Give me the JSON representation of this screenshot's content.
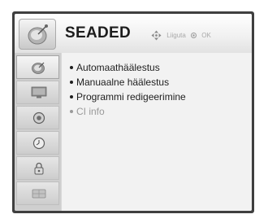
{
  "header": {
    "title": "SEADED",
    "icon": "satellite-dish-icon",
    "hints": [
      {
        "icon": "navigation-arrows-icon",
        "label": "Liiguta"
      },
      {
        "icon": "ok-button-icon",
        "label": "OK"
      }
    ]
  },
  "sidebar": {
    "items": [
      {
        "icon": "satellite-dish-icon",
        "active": true
      },
      {
        "icon": "monitor-icon",
        "active": false
      },
      {
        "icon": "speaker-icon",
        "active": false
      },
      {
        "icon": "clock-icon",
        "active": false
      },
      {
        "icon": "lock-icon",
        "active": false
      },
      {
        "icon": "globe-icon",
        "active": false
      }
    ]
  },
  "menu": {
    "items": [
      {
        "label": "Automaathäälestus",
        "enabled": true
      },
      {
        "label": "Manuaalne häälestus",
        "enabled": true
      },
      {
        "label": "Programmi redigeerimine",
        "enabled": true
      },
      {
        "label": "CI info",
        "enabled": false
      }
    ]
  },
  "colors": {
    "frame": "#3f3f3f",
    "text": "#1e1e1e",
    "disabled_text": "#9a9a9a",
    "hint_text": "#a9a9a9"
  }
}
